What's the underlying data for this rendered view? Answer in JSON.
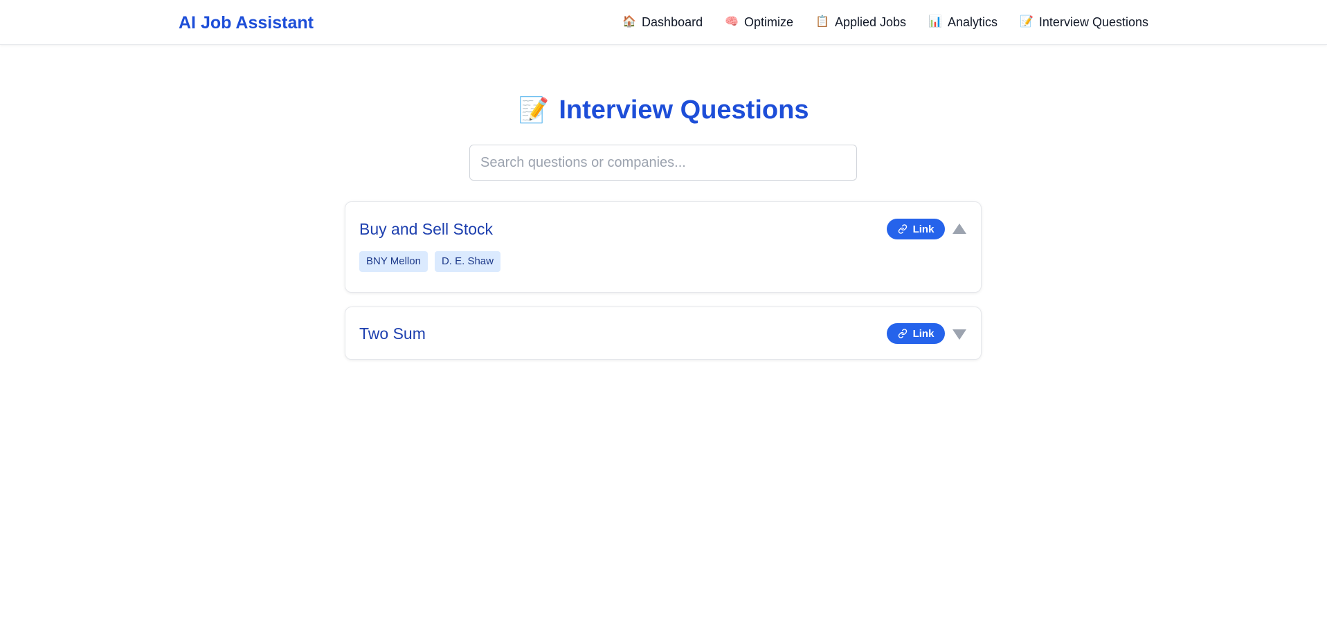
{
  "app": {
    "brand": "AI Job Assistant"
  },
  "nav": {
    "items": [
      {
        "icon": "🏠",
        "icon_name": "house-icon",
        "label": "Dashboard"
      },
      {
        "icon": "🧠",
        "icon_name": "brain-icon",
        "label": "Optimize"
      },
      {
        "icon": "📋",
        "icon_name": "clipboard-icon",
        "label": "Applied Jobs"
      },
      {
        "icon": "📊",
        "icon_name": "bar-chart-icon",
        "label": "Analytics"
      },
      {
        "icon": "📝",
        "icon_name": "memo-icon",
        "label": "Interview Questions"
      }
    ]
  },
  "page": {
    "title_icon": "📝",
    "title": "Interview Questions"
  },
  "search": {
    "value": "",
    "placeholder": "Search questions or companies..."
  },
  "questions": [
    {
      "title": "Buy and Sell Stock",
      "link_label": "Link",
      "expanded": true,
      "companies": [
        "BNY Mellon",
        "D. E. Shaw"
      ]
    },
    {
      "title": "Two Sum",
      "link_label": "Link",
      "expanded": false,
      "companies": []
    }
  ],
  "colors": {
    "accent": "#2563eb",
    "brand": "#1d4ed8",
    "tag_bg": "#dbeafe",
    "toggle": "#9ca3af"
  }
}
